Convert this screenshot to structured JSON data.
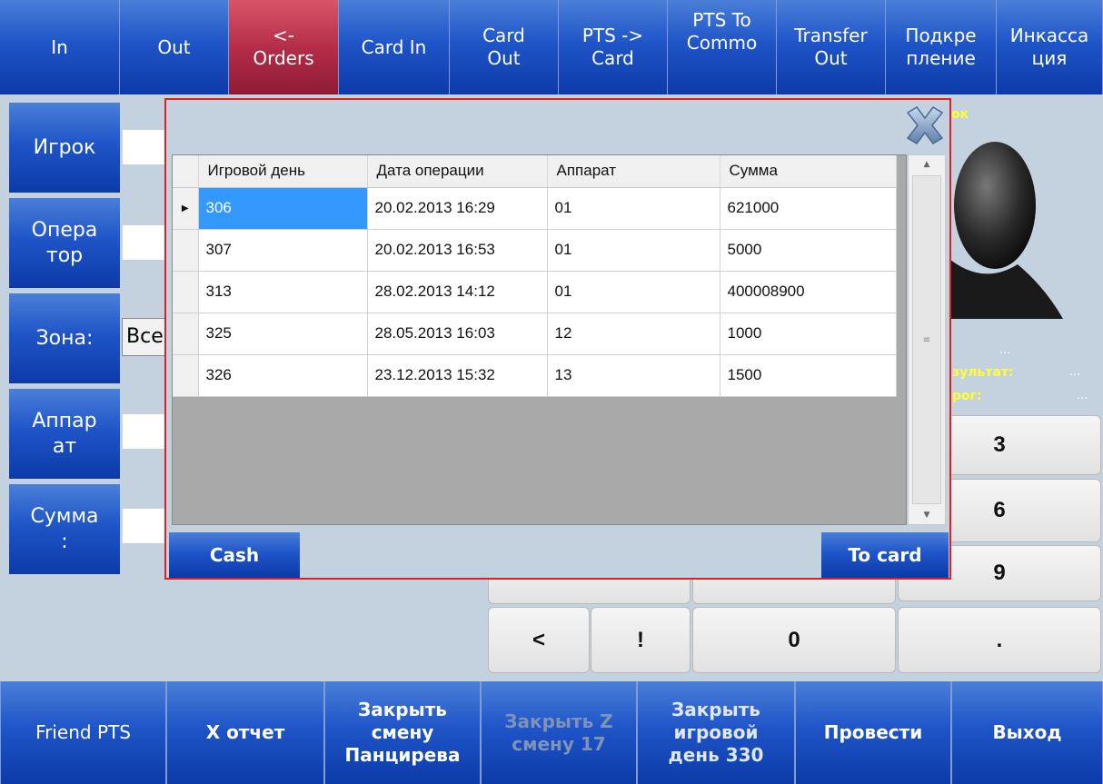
{
  "top_tabs": [
    {
      "label": "In"
    },
    {
      "label": "Out"
    },
    {
      "label": "<-\nOrders"
    },
    {
      "label": "Card In"
    },
    {
      "label": "Card\nOut"
    },
    {
      "label": "PTS ->\nCard"
    },
    {
      "label": "PTS To\nCommo"
    },
    {
      "label": "Transfer\nOut"
    },
    {
      "label": "Подкре\nпление"
    },
    {
      "label": "Инкасса\nция"
    }
  ],
  "side_buttons": [
    {
      "label": "Игрок"
    },
    {
      "label": "Опера\nтор"
    },
    {
      "label": "Зона:"
    },
    {
      "label": "Аппар\nат"
    },
    {
      "label": "Сумма\n:"
    }
  ],
  "zone_select": {
    "value": "Все"
  },
  "player_panel": {
    "name_fragment": "ок",
    "dots": "...",
    "result_label": "зультат:",
    "result_value": "...",
    "threshold_label": "рог:",
    "threshold_value": "..."
  },
  "keypad": {
    "k3": "3",
    "k6": "6",
    "k9": "9",
    "less": "<",
    "excl": "!",
    "zero": "0",
    "dot": "."
  },
  "modal": {
    "columns": [
      "Игровой день",
      "Дата операции",
      "Аппарат",
      "Сумма"
    ],
    "rows": [
      {
        "day": "306",
        "date": "20.02.2013 16:29",
        "machine": "01",
        "amount": "621000"
      },
      {
        "day": "307",
        "date": "20.02.2013 16:53",
        "machine": "01",
        "amount": "5000"
      },
      {
        "day": "313",
        "date": "28.02.2013 14:12",
        "machine": "01",
        "amount": "400008900"
      },
      {
        "day": "325",
        "date": "28.05.2013 16:03",
        "machine": "12",
        "amount": "1000"
      },
      {
        "day": "326",
        "date": "23.12.2013 15:32",
        "machine": "13",
        "amount": "1500"
      }
    ],
    "cash_label": "Cash",
    "tocard_label": "To card"
  },
  "bottom_buttons": [
    {
      "label": "Friend PTS"
    },
    {
      "label": "X отчет"
    },
    {
      "label": "Закрыть\nсмену\nПанцирева"
    },
    {
      "label": "Закрыть Z\nсмену 17"
    },
    {
      "label": "Закрыть\nигровой\nдень 330"
    },
    {
      "label": "Провести"
    },
    {
      "label": "Выход"
    }
  ],
  "colors": {
    "accent": "#1f55c8",
    "active_tab": "#b52d48",
    "modal_border": "#e02020",
    "selected_cell": "#3399ff"
  }
}
